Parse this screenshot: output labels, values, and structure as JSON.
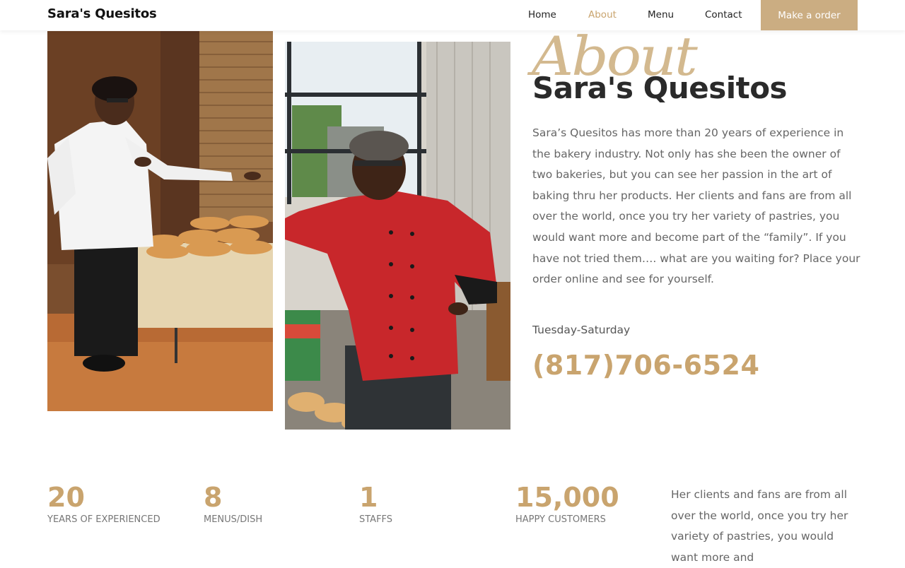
{
  "header": {
    "brand": "Sara's Quesitos",
    "nav": [
      {
        "label": "Home",
        "active": false
      },
      {
        "label": "About",
        "active": true
      },
      {
        "label": "Menu",
        "active": false
      },
      {
        "label": "Contact",
        "active": false
      }
    ],
    "cta_label": "Make a order"
  },
  "about": {
    "script_word": "About",
    "title": "Sara's Quesitos",
    "body": "Sara’s Quesitos has more than 20 years of experience in the bakery industry. Not only has she been the owner of two bakeries, but you can see her passion in the art of baking thru her products. Her clients and fans are from all over the world, once you try her variety of pastries, you would want more and become part of the “family”. If you have not tried them…. what are you waiting for? Place your order online and see for yourself.",
    "hours": "Tuesday-Saturday",
    "phone": "(817)706-6524"
  },
  "stats": [
    {
      "value": "20",
      "label": "YEARS OF EXPERIENCED"
    },
    {
      "value": "8",
      "label": "MENUS/DISH"
    },
    {
      "value": "1",
      "label": "STAFFS"
    },
    {
      "value": "15,000",
      "label": "HAPPY CUSTOMERS"
    }
  ],
  "stats_text": "Her clients and fans are from all over the world, once you try her variety of pastries, you would want more and",
  "colors": {
    "accent": "#c9a46e",
    "cta_bg": "#cbad82",
    "title": "#2a2a2a"
  }
}
